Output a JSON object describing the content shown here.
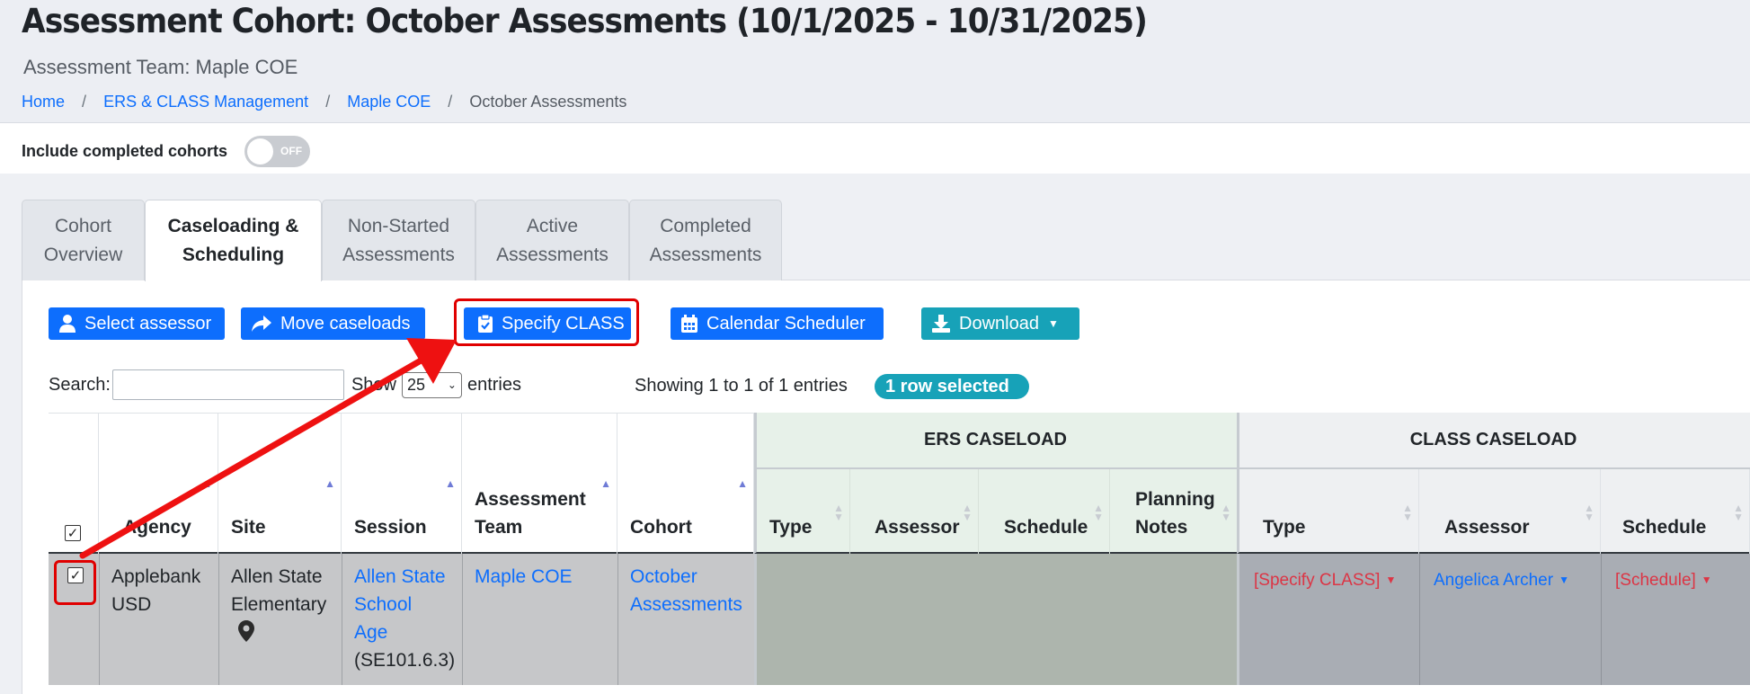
{
  "header": {
    "title": "Assessment Cohort: October Assessments (10/1/2025 - 10/31/2025)",
    "subtitle": "Assessment Team: Maple COE",
    "breadcrumb": [
      "Home",
      "ERS & CLASS Management",
      "Maple COE",
      "October Assessments"
    ]
  },
  "toggle": {
    "label": "Include completed cohorts",
    "state": "OFF"
  },
  "tabs": [
    {
      "label": "Cohort\nOverview",
      "active": false
    },
    {
      "label": "Caseloading &\nScheduling",
      "active": true
    },
    {
      "label": "Non-Started\nAssessments",
      "active": false
    },
    {
      "label": "Active\nAssessments",
      "active": false
    },
    {
      "label": "Completed\nAssessments",
      "active": false
    }
  ],
  "toolbar": {
    "select_assessor": "Select assessor",
    "move_caseloads": "Move caseloads",
    "specify_class": "Specify CLASS",
    "calendar_scheduler": "Calendar Scheduler",
    "download": "Download"
  },
  "table_controls": {
    "search_label": "Search:",
    "show_label": "Show",
    "page_size": "25",
    "entries_label": "entries",
    "showing": "Showing 1 to 1 of 1 entries",
    "selected_badge": "1 row selected"
  },
  "table": {
    "group_headers": {
      "ers": "ERS CASELOAD",
      "class": "CLASS CASELOAD"
    },
    "columns": {
      "agency": "Agency",
      "site": "Site",
      "session": "Session",
      "assessment_team": "Assessment\nTeam",
      "cohort": "Cohort",
      "ers_type": "Type",
      "ers_assessor": "Assessor",
      "ers_schedule": "Schedule",
      "ers_planning": "Planning\nNotes",
      "class_type": "Type",
      "class_assessor": "Assessor",
      "class_schedule": "Schedule"
    },
    "rows": [
      {
        "agency": "Applebank\nUSD",
        "site": "Allen State\nElementary",
        "session_link": "Allen State\nSchool\nAge",
        "session_code": "(SE101.6.3)",
        "team": "Maple COE",
        "cohort": "October\nAssessments",
        "class_type": "[Specify CLASS]",
        "class_assessor": "Angelica Archer",
        "class_schedule": "[Schedule]"
      }
    ]
  },
  "colors": {
    "primary": "#0d6efd",
    "info": "#17a2b8",
    "danger": "#dc3545",
    "annotation": "#e00000",
    "ers_header": "#e7f1e9",
    "ers_body": "#adb5ad",
    "class_body": "#a9adb4",
    "row_selected": "#c6c7c9"
  }
}
